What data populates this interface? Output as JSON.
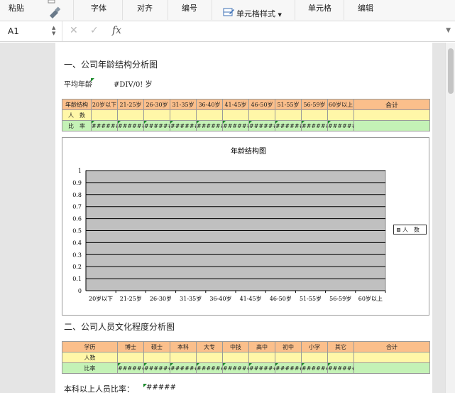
{
  "ribbon": {
    "paste": "粘贴",
    "font": "字体",
    "align": "对齐",
    "number": "编号",
    "cell_style": "单元格样式",
    "cells": "单元格",
    "edit": "编辑"
  },
  "formula_bar": {
    "name_box": "A1",
    "fx": "fx"
  },
  "section1": {
    "title": "一、公司年龄结构分析图",
    "avg_label": "平均年龄",
    "avg_value": "#DIV/0! 岁",
    "table": {
      "header": [
        "年龄结构",
        "20岁以下",
        "21-25岁",
        "26-30岁",
        "31-35岁",
        "36-40岁",
        "41-45岁",
        "46-50岁",
        "51-55岁",
        "56-59岁",
        "60岁以上",
        "合计"
      ],
      "row_count_label": "人　数",
      "row_ratio_label": "比　率",
      "ratio_values": [
        "######",
        "######",
        "######",
        "######",
        "######",
        "######",
        "######",
        "######",
        "######",
        "######"
      ]
    }
  },
  "chart_data": {
    "type": "bar",
    "title": "年龄结构图",
    "categories": [
      "20岁以下",
      "21-25岁",
      "26-30岁",
      "31-35岁",
      "36-40岁",
      "41-45岁",
      "46-50岁",
      "51-55岁",
      "56-59岁",
      "60岁以上"
    ],
    "series": [
      {
        "name": "人　数",
        "values": [
          0,
          0,
          0,
          0,
          0,
          0,
          0,
          0,
          0,
          0
        ]
      }
    ],
    "yticks": [
      "0",
      "0.1",
      "0.2",
      "0.3",
      "0.4",
      "0.5",
      "0.6",
      "0.7",
      "0.8",
      "0.9",
      "1"
    ],
    "ylim": [
      0,
      1
    ],
    "grid": true,
    "legend": "right",
    "plot_bg": "#c0c0c0"
  },
  "section2": {
    "title": "二、公司人员文化程度分析图",
    "table": {
      "header": [
        "学历",
        "博士",
        "硕士",
        "本科",
        "大专",
        "中技",
        "高中",
        "初中",
        "小学",
        "其它",
        "合计"
      ],
      "row_count_label": "人数",
      "row_ratio_label": "比率",
      "ratio_values": [
        "######",
        "######",
        "######",
        "######",
        "######",
        "######",
        "######",
        "######",
        "######"
      ]
    },
    "summary_label": "本科以上人员比率：",
    "summary_value": "#####"
  },
  "colors": {
    "header_orange": "#fbbf8b",
    "count_yellow": "#fff7a8",
    "ratio_green": "#c4f2b6"
  }
}
